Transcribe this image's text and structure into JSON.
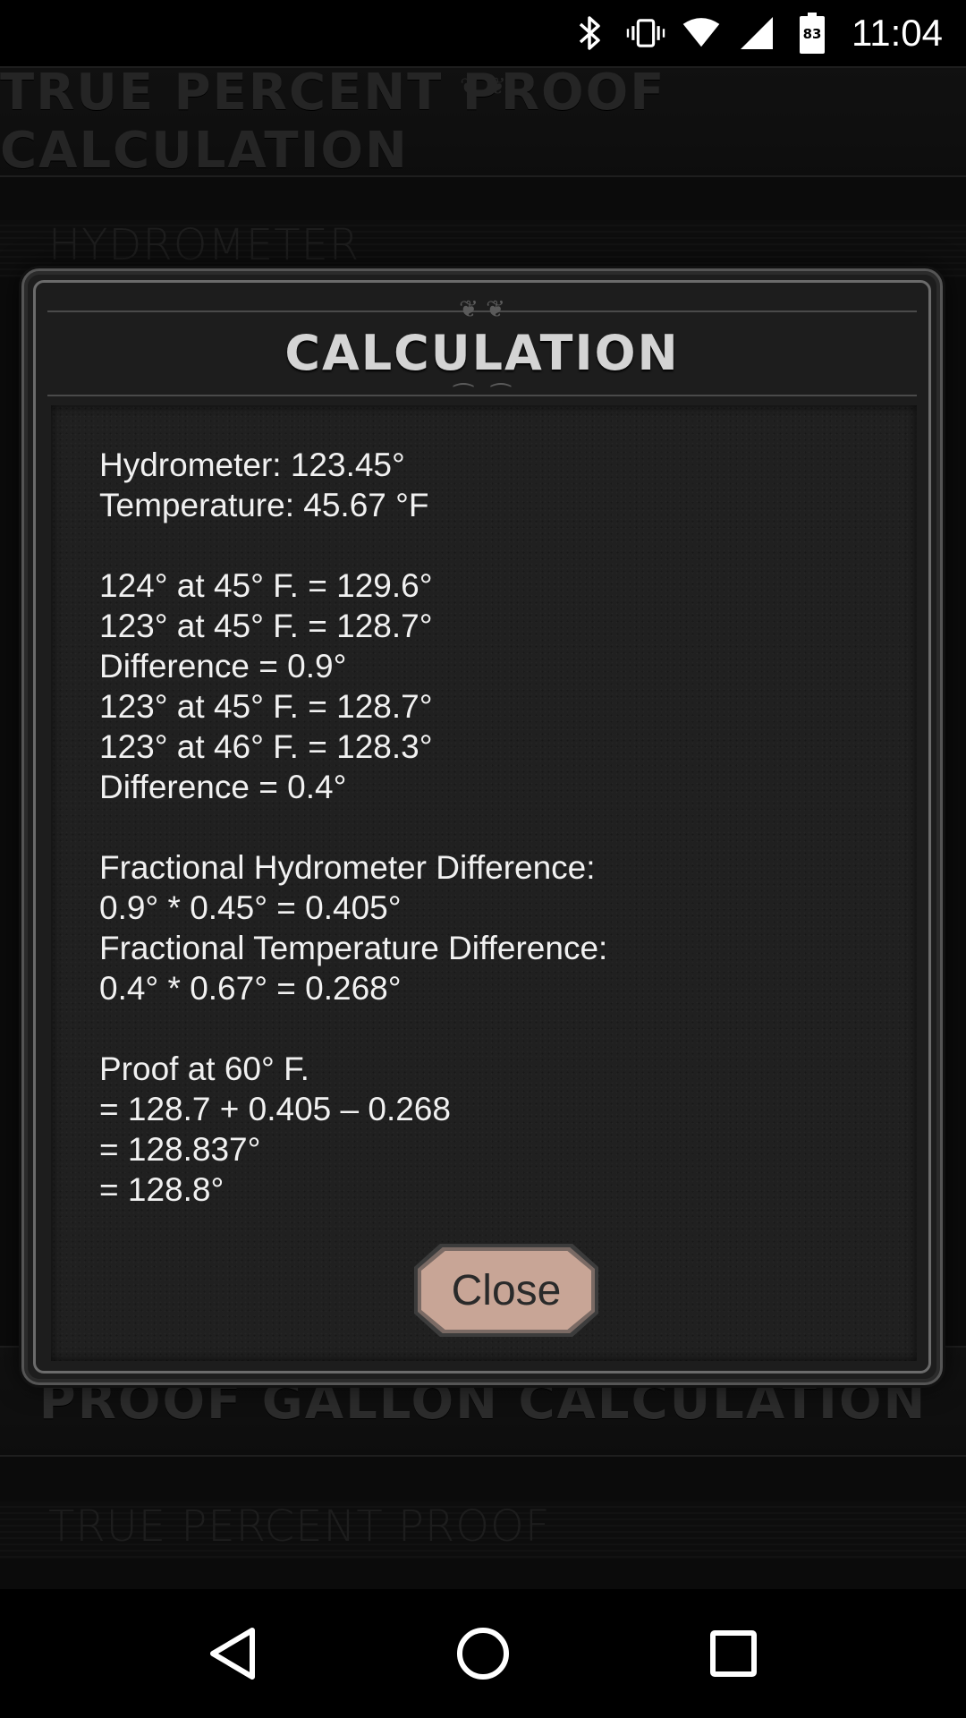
{
  "status_bar": {
    "time": "11:04",
    "battery_level": "83",
    "icons": [
      "bluetooth-icon",
      "vibrate-icon",
      "wifi-icon",
      "signal-icon",
      "battery-icon"
    ]
  },
  "background_app": {
    "header_title": "TRUE PERCENT PROOF CALCULATION",
    "section_hydrometer": "HYDROMETER",
    "header2_title": "PROOF GALLON CALCULATION",
    "section_true_percent": "TRUE PERCENT PROOF"
  },
  "dialog": {
    "title": "CALCULATION",
    "lines": [
      "Hydrometer: 123.45°",
      "Temperature: 45.67 °F",
      "",
      "124° at 45° F. = 129.6°",
      "123° at 45° F. = 128.7°",
      "Difference = 0.9°",
      "123° at 45° F. = 128.7°",
      "123° at 46° F. = 128.3°",
      "Difference = 0.4°",
      "",
      "Fractional Hydrometer Difference:",
      "0.9° * 0.45° = 0.405°",
      "Fractional Temperature Difference:",
      "0.4° * 0.67° = 0.268°",
      "",
      "Proof at 60° F.",
      "= 128.7 + 0.405 – 0.268",
      "= 128.837°",
      "= 128.8°"
    ],
    "close_label": "Close"
  },
  "colors": {
    "close_button": "#c8a596",
    "dialog_text": "#f1f1f1",
    "dialog_title": "#d4d4d4"
  }
}
